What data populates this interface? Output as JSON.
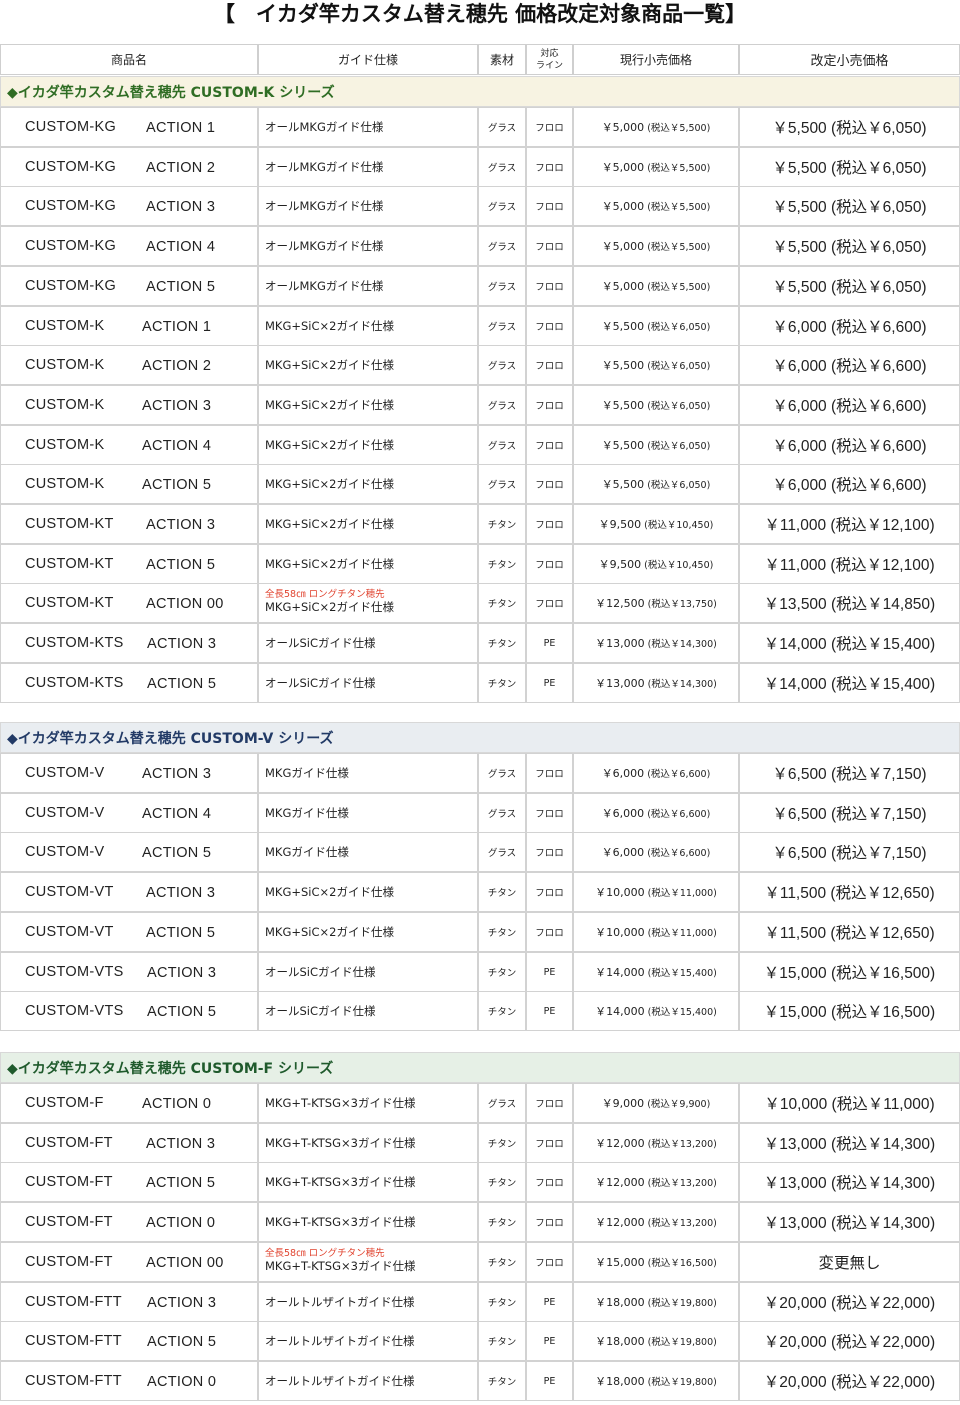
{
  "title": "【　イカダ竿カスタム替え穂先 価格改定対象商品一覧】",
  "headers": {
    "name": "商品名",
    "guide": "ガイド仕様",
    "material": "素材",
    "line_1": "対応",
    "line_2": "ライン",
    "current": "現行小売価格",
    "new": "改定小売価格"
  },
  "colors": {
    "title_text": "#111111",
    "note_red": "#e0432f"
  },
  "sections": [
    {
      "title": "◆イカダ竿カスタム替え穂先 CUSTOM-K シリーズ",
      "color": "#2f6d24",
      "bg": "#f7f3e2",
      "rows": [
        {
          "model": "CUSTOM-KG",
          "action": "ACTION 1",
          "note": "",
          "guide": "オールMKGガイド仕様",
          "material": "グラス",
          "line": "フロロ",
          "cur": "￥5,000",
          "cur_tax": "(税込￥5,500)",
          "new": "￥5,500 (税込￥6,050)"
        },
        {
          "model": "CUSTOM-KG",
          "action": "ACTION 2",
          "note": "",
          "guide": "オールMKGガイド仕様",
          "material": "グラス",
          "line": "フロロ",
          "cur": "￥5,000",
          "cur_tax": "(税込￥5,500)",
          "new": "￥5,500 (税込￥6,050)"
        },
        {
          "model": "CUSTOM-KG",
          "action": "ACTION 3",
          "note": "",
          "guide": "オールMKGガイド仕様",
          "material": "グラス",
          "line": "フロロ",
          "cur": "￥5,000",
          "cur_tax": "(税込￥5,500)",
          "new": "￥5,500 (税込￥6,050)"
        },
        {
          "model": "CUSTOM-KG",
          "action": "ACTION 4",
          "note": "",
          "guide": "オールMKGガイド仕様",
          "material": "グラス",
          "line": "フロロ",
          "cur": "￥5,000",
          "cur_tax": "(税込￥5,500)",
          "new": "￥5,500 (税込￥6,050)"
        },
        {
          "model": "CUSTOM-KG",
          "action": "ACTION 5",
          "note": "",
          "guide": "オールMKGガイド仕様",
          "material": "グラス",
          "line": "フロロ",
          "cur": "￥5,000",
          "cur_tax": "(税込￥5,500)",
          "new": "￥5,500 (税込￥6,050)"
        },
        {
          "model": "CUSTOM-K",
          "action": "ACTION 1",
          "note": "",
          "guide": "MKG+SiC×2ガイド仕様",
          "material": "グラス",
          "line": "フロロ",
          "cur": "￥5,500",
          "cur_tax": "(税込￥6,050)",
          "new": "￥6,000 (税込￥6,600)"
        },
        {
          "model": "CUSTOM-K",
          "action": "ACTION 2",
          "note": "",
          "guide": "MKG+SiC×2ガイド仕様",
          "material": "グラス",
          "line": "フロロ",
          "cur": "￥5,500",
          "cur_tax": "(税込￥6,050)",
          "new": "￥6,000 (税込￥6,600)"
        },
        {
          "model": "CUSTOM-K",
          "action": "ACTION 3",
          "note": "",
          "guide": "MKG+SiC×2ガイド仕様",
          "material": "グラス",
          "line": "フロロ",
          "cur": "￥5,500",
          "cur_tax": "(税込￥6,050)",
          "new": "￥6,000 (税込￥6,600)"
        },
        {
          "model": "CUSTOM-K",
          "action": "ACTION 4",
          "note": "",
          "guide": "MKG+SiC×2ガイド仕様",
          "material": "グラス",
          "line": "フロロ",
          "cur": "￥5,500",
          "cur_tax": "(税込￥6,050)",
          "new": "￥6,000 (税込￥6,600)"
        },
        {
          "model": "CUSTOM-K",
          "action": "ACTION 5",
          "note": "",
          "guide": "MKG+SiC×2ガイド仕様",
          "material": "グラス",
          "line": "フロロ",
          "cur": "￥5,500",
          "cur_tax": "(税込￥6,050)",
          "new": "￥6,000 (税込￥6,600)"
        },
        {
          "model": "CUSTOM-KT",
          "action": "ACTION 3",
          "note": "",
          "guide": "MKG+SiC×2ガイド仕様",
          "material": "チタン",
          "line": "フロロ",
          "cur": "￥9,500",
          "cur_tax": "(税込￥10,450)",
          "new": "￥11,000 (税込￥12,100)"
        },
        {
          "model": "CUSTOM-KT",
          "action": "ACTION 5",
          "note": "",
          "guide": "MKG+SiC×2ガイド仕様",
          "material": "チタン",
          "line": "フロロ",
          "cur": "￥9,500",
          "cur_tax": "(税込￥10,450)",
          "new": "￥11,000 (税込￥12,100)"
        },
        {
          "model": "CUSTOM-KT",
          "action": "ACTION 00",
          "note": "全長58㎝ ロングチタン穂先",
          "guide": "MKG+SiC×2ガイド仕様",
          "material": "チタン",
          "line": "フロロ",
          "cur": "￥12,500",
          "cur_tax": "(税込￥13,750)",
          "new": "￥13,500 (税込￥14,850)"
        },
        {
          "model": "CUSTOM-KTS",
          "action": "ACTION 3",
          "note": "",
          "guide": "オールSiCガイド仕様",
          "material": "チタン",
          "line": "PE",
          "cur": "￥13,000",
          "cur_tax": "(税込￥14,300)",
          "new": "￥14,000 (税込￥15,400)"
        },
        {
          "model": "CUSTOM-KTS",
          "action": "ACTION 5",
          "note": "",
          "guide": "オールSiCガイド仕様",
          "material": "チタン",
          "line": "PE",
          "cur": "￥13,000",
          "cur_tax": "(税込￥14,300)",
          "new": "￥14,000 (税込￥15,400)"
        }
      ]
    },
    {
      "title": "◆イカダ竿カスタム替え穂先 CUSTOM-V シリーズ",
      "color": "#223a66",
      "bg": "#e9edf1",
      "rows": [
        {
          "model": "CUSTOM-V",
          "action": "ACTION 3",
          "note": "",
          "guide": "MKGガイド仕様",
          "material": "グラス",
          "line": "フロロ",
          "cur": "￥6,000",
          "cur_tax": "(税込￥6,600)",
          "new": "￥6,500 (税込￥7,150)"
        },
        {
          "model": "CUSTOM-V",
          "action": "ACTION 4",
          "note": "",
          "guide": "MKGガイド仕様",
          "material": "グラス",
          "line": "フロロ",
          "cur": "￥6,000",
          "cur_tax": "(税込￥6,600)",
          "new": "￥6,500 (税込￥7,150)"
        },
        {
          "model": "CUSTOM-V",
          "action": "ACTION 5",
          "note": "",
          "guide": "MKGガイド仕様",
          "material": "グラス",
          "line": "フロロ",
          "cur": "￥6,000",
          "cur_tax": "(税込￥6,600)",
          "new": "￥6,500 (税込￥7,150)"
        },
        {
          "model": "CUSTOM-VT",
          "action": "ACTION 3",
          "note": "",
          "guide": "MKG+SiC×2ガイド仕様",
          "material": "チタン",
          "line": "フロロ",
          "cur": "￥10,000",
          "cur_tax": "(税込￥11,000)",
          "new": "￥11,500 (税込￥12,650)"
        },
        {
          "model": "CUSTOM-VT",
          "action": "ACTION 5",
          "note": "",
          "guide": "MKG+SiC×2ガイド仕様",
          "material": "チタン",
          "line": "フロロ",
          "cur": "￥10,000",
          "cur_tax": "(税込￥11,000)",
          "new": "￥11,500 (税込￥12,650)"
        },
        {
          "model": "CUSTOM-VTS",
          "action": "ACTION 3",
          "note": "",
          "guide": "オールSiCガイド仕様",
          "material": "チタン",
          "line": "PE",
          "cur": "￥14,000",
          "cur_tax": "(税込￥15,400)",
          "new": "￥15,000 (税込￥16,500)"
        },
        {
          "model": "CUSTOM-VTS",
          "action": "ACTION 5",
          "note": "",
          "guide": "オールSiCガイド仕様",
          "material": "チタン",
          "line": "PE",
          "cur": "￥14,000",
          "cur_tax": "(税込￥15,400)",
          "new": "￥15,000 (税込￥16,500)"
        }
      ]
    },
    {
      "title": "◆イカダ竿カスタム替え穂先 CUSTOM-F シリーズ",
      "color": "#1f5a2c",
      "bg": "#e6f0e6",
      "rows": [
        {
          "model": "CUSTOM-F",
          "action": "ACTION 0",
          "note": "",
          "guide": "MKG+T-KTSG×3ガイド仕様",
          "material": "グラス",
          "line": "フロロ",
          "cur": "￥9,000",
          "cur_tax": "(税込￥9,900)",
          "new": "￥10,000 (税込￥11,000)"
        },
        {
          "model": "CUSTOM-FT",
          "action": "ACTION 3",
          "note": "",
          "guide": "MKG+T-KTSG×3ガイド仕様",
          "material": "チタン",
          "line": "フロロ",
          "cur": "￥12,000",
          "cur_tax": "(税込￥13,200)",
          "new": "￥13,000 (税込￥14,300)"
        },
        {
          "model": "CUSTOM-FT",
          "action": "ACTION 5",
          "note": "",
          "guide": "MKG+T-KTSG×3ガイド仕様",
          "material": "チタン",
          "line": "フロロ",
          "cur": "￥12,000",
          "cur_tax": "(税込￥13,200)",
          "new": "￥13,000 (税込￥14,300)"
        },
        {
          "model": "CUSTOM-FT",
          "action": "ACTION 0",
          "note": "",
          "guide": "MKG+T-KTSG×3ガイド仕様",
          "material": "チタン",
          "line": "フロロ",
          "cur": "￥12,000",
          "cur_tax": "(税込￥13,200)",
          "new": "￥13,000 (税込￥14,300)"
        },
        {
          "model": "CUSTOM-FT",
          "action": "ACTION 00",
          "note": "全長58㎝ ロングチタン穂先",
          "guide": "MKG+T-KTSG×3ガイド仕様",
          "material": "チタン",
          "line": "フロロ",
          "cur": "￥15,000",
          "cur_tax": "(税込￥16,500)",
          "new": "変更無し"
        },
        {
          "model": "CUSTOM-FTT",
          "action": "ACTION 3",
          "note": "",
          "guide": "オールトルザイトガイド仕様",
          "material": "チタン",
          "line": "PE",
          "cur": "￥18,000",
          "cur_tax": "(税込￥19,800)",
          "new": "￥20,000 (税込￥22,000)"
        },
        {
          "model": "CUSTOM-FTT",
          "action": "ACTION 5",
          "note": "",
          "guide": "オールトルザイトガイド仕様",
          "material": "チタン",
          "line": "PE",
          "cur": "￥18,000",
          "cur_tax": "(税込￥19,800)",
          "new": "￥20,000 (税込￥22,000)"
        },
        {
          "model": "CUSTOM-FTT",
          "action": "ACTION 0",
          "note": "",
          "guide": "オールトルザイトガイド仕様",
          "material": "チタン",
          "line": "PE",
          "cur": "￥18,000",
          "cur_tax": "(税込￥19,800)",
          "new": "￥20,000 (税込￥22,000)"
        }
      ]
    }
  ]
}
